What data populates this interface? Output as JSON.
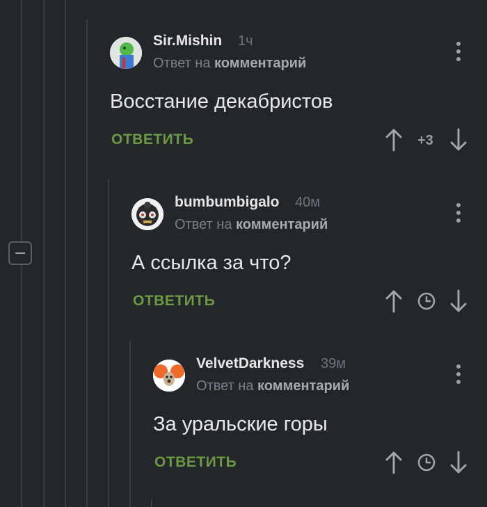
{
  "comments": [
    {
      "author": "Sir.Mishin",
      "time": "1ч",
      "reply_prefix": "Ответ на",
      "reply_target": "комментарий",
      "text": "Восстание декабристов",
      "reply_label": "ОТВЕТИТЬ",
      "score": "+3"
    },
    {
      "author": "bumbumbigalo",
      "time": "40м",
      "reply_prefix": "Ответ на",
      "reply_target": "комментарий",
      "text": "А ссылка за что?",
      "reply_label": "ОТВЕТИТЬ"
    },
    {
      "author": "VelvetDarkness",
      "time": "39м",
      "reply_prefix": "Ответ на",
      "reply_target": "комментарий",
      "text": "За уральские горы",
      "reply_label": "ОТВЕТИТЬ"
    }
  ],
  "icons": {
    "upvote": "arrow-up-icon",
    "downvote": "arrow-down-icon",
    "pending": "clock-icon",
    "menu": "more-vertical-icon",
    "collapse": "minus-icon"
  },
  "colors": {
    "background": "#23262a",
    "accent_green": "#6c9a43",
    "thread_line": "#3b3f44"
  }
}
